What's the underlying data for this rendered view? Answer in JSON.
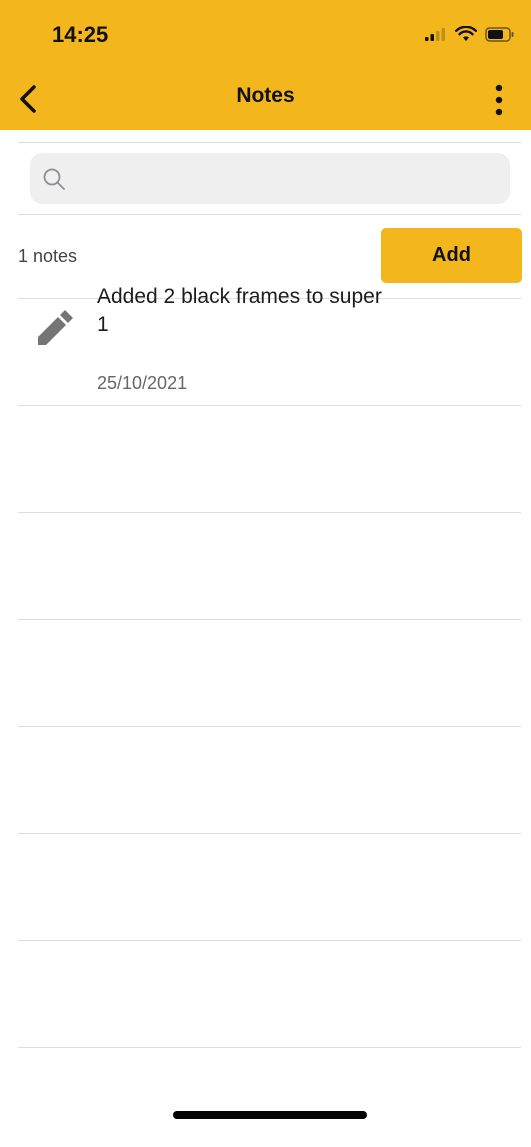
{
  "status_bar": {
    "time": "14:25"
  },
  "header": {
    "title": "Notes",
    "background": "#f3b61c"
  },
  "search": {
    "placeholder": "",
    "value": ""
  },
  "toolbar": {
    "count_label": "1 notes",
    "add_label": "Add"
  },
  "notes": [
    {
      "text": "Added 2 black frames to super 1",
      "date": "25/10/2021",
      "icon": "pencil-icon"
    }
  ]
}
